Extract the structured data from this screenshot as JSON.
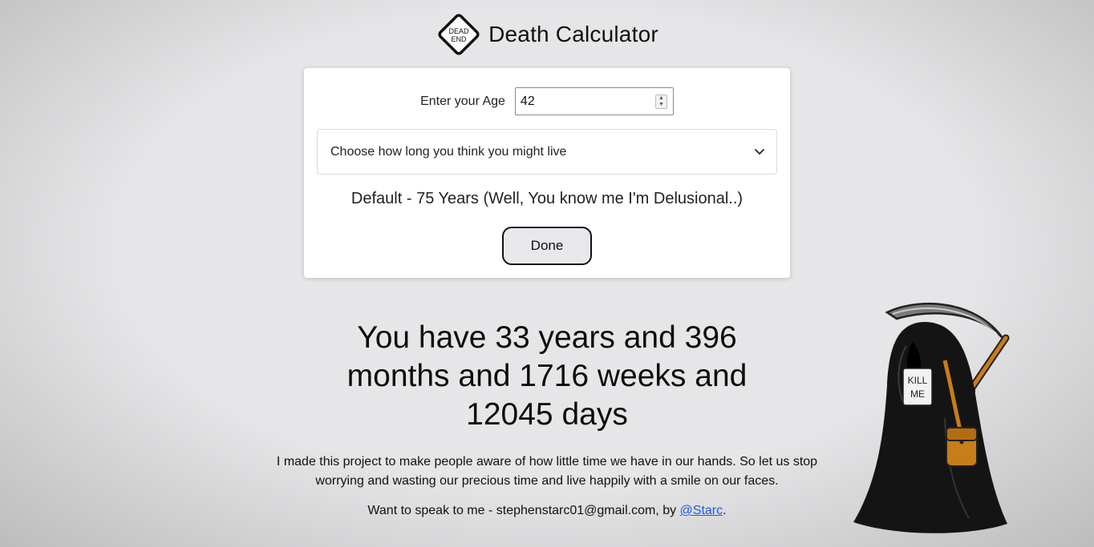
{
  "header": {
    "logo_line1": "DEAD",
    "logo_line2": "END",
    "title": "Death Calculator"
  },
  "form": {
    "age_label": "Enter your Age",
    "age_value": "42",
    "lifespan_select": "Choose how long you think you might live",
    "default_text": "Default - 75 Years (Well, You know me I'm Delusional..)",
    "done_label": "Done"
  },
  "result": {
    "text": "You have 33 years and 396 months and 1716 weeks and 12045 days"
  },
  "footer": {
    "about": "I made this project to make people aware of how little time we have in our hands. So let us stop worrying and wasting our precious time and live happily with a smile on our faces.",
    "contact_prefix": "Want to speak to me - stephenstarc01@gmail.com, by ",
    "contact_link": "@Starc",
    "contact_suffix": "."
  },
  "illustration": {
    "sign_line1": "KILL",
    "sign_line2": "ME"
  },
  "colors": {
    "background": "#e6e6e8",
    "card": "#ffffff",
    "link": "#1a5be8",
    "button_bg": "#e7e7ec"
  }
}
